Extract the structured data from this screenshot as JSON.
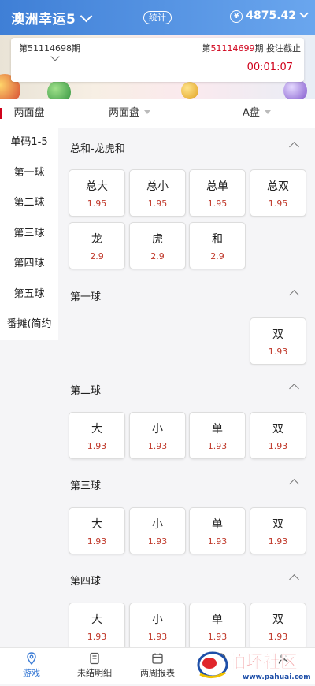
{
  "header": {
    "game_title": "澳洲幸运5",
    "stats_label": "统计",
    "balance": "4875.42"
  },
  "draw": {
    "prev_period": "第51114698期",
    "cur_prefix": "第",
    "cur_number": "51114699",
    "cur_suffix": "期 投注截止",
    "countdown": "00:01:07"
  },
  "tabs": {
    "active": "两面盘",
    "play_type": "两面盘",
    "market": "A盘"
  },
  "sidebar": {
    "items": [
      {
        "label": "单码1-5"
      },
      {
        "label": "第一球"
      },
      {
        "label": "第二球"
      },
      {
        "label": "第三球"
      },
      {
        "label": "第四球"
      },
      {
        "label": "第五球"
      },
      {
        "label": "番摊(简约"
      }
    ]
  },
  "sections": [
    {
      "title": "总和-龙虎和",
      "options": [
        {
          "name": "总大",
          "odds": "1.95"
        },
        {
          "name": "总小",
          "odds": "1.95"
        },
        {
          "name": "总单",
          "odds": "1.95"
        },
        {
          "name": "总双",
          "odds": "1.95"
        },
        {
          "name": "龙",
          "odds": "2.9"
        },
        {
          "name": "虎",
          "odds": "2.9"
        },
        {
          "name": "和",
          "odds": "2.9"
        }
      ]
    },
    {
      "title": "第一球",
      "options": [
        {
          "name": "",
          "odds": ""
        },
        {
          "name": "",
          "odds": ""
        },
        {
          "name": "",
          "odds": ""
        },
        {
          "name": "双",
          "odds": "1.93"
        }
      ]
    },
    {
      "title": "第二球",
      "options": [
        {
          "name": "大",
          "odds": "1.93"
        },
        {
          "name": "小",
          "odds": "1.93"
        },
        {
          "name": "单",
          "odds": "1.93"
        },
        {
          "name": "双",
          "odds": "1.93"
        }
      ]
    },
    {
      "title": "第三球",
      "options": [
        {
          "name": "大",
          "odds": "1.93"
        },
        {
          "name": "小",
          "odds": "1.93"
        },
        {
          "name": "单",
          "odds": "1.93"
        },
        {
          "name": "双",
          "odds": "1.93"
        }
      ]
    },
    {
      "title": "第四球",
      "options": [
        {
          "name": "大",
          "odds": "1.93"
        },
        {
          "name": "小",
          "odds": "1.93"
        },
        {
          "name": "单",
          "odds": "1.93"
        },
        {
          "name": "双",
          "odds": "1.93"
        }
      ]
    }
  ],
  "bottom_nav": [
    {
      "label": "游戏",
      "icon": "location-icon"
    },
    {
      "label": "未结明细",
      "icon": "document-icon"
    },
    {
      "label": "两周报表",
      "icon": "calendar-icon"
    },
    {
      "label": "",
      "icon": "history-icon"
    },
    {
      "label": "",
      "icon": "user-icon"
    }
  ],
  "watermark": {
    "text": "怕坏社区",
    "url_text": "www.pahuai.com"
  },
  "colors": {
    "header_start": "#3f7fd6",
    "header_end": "#6aa6ee",
    "accent_red": "#d0021b",
    "odds_red": "#c0392b",
    "nav_active": "#3a7bd5"
  }
}
